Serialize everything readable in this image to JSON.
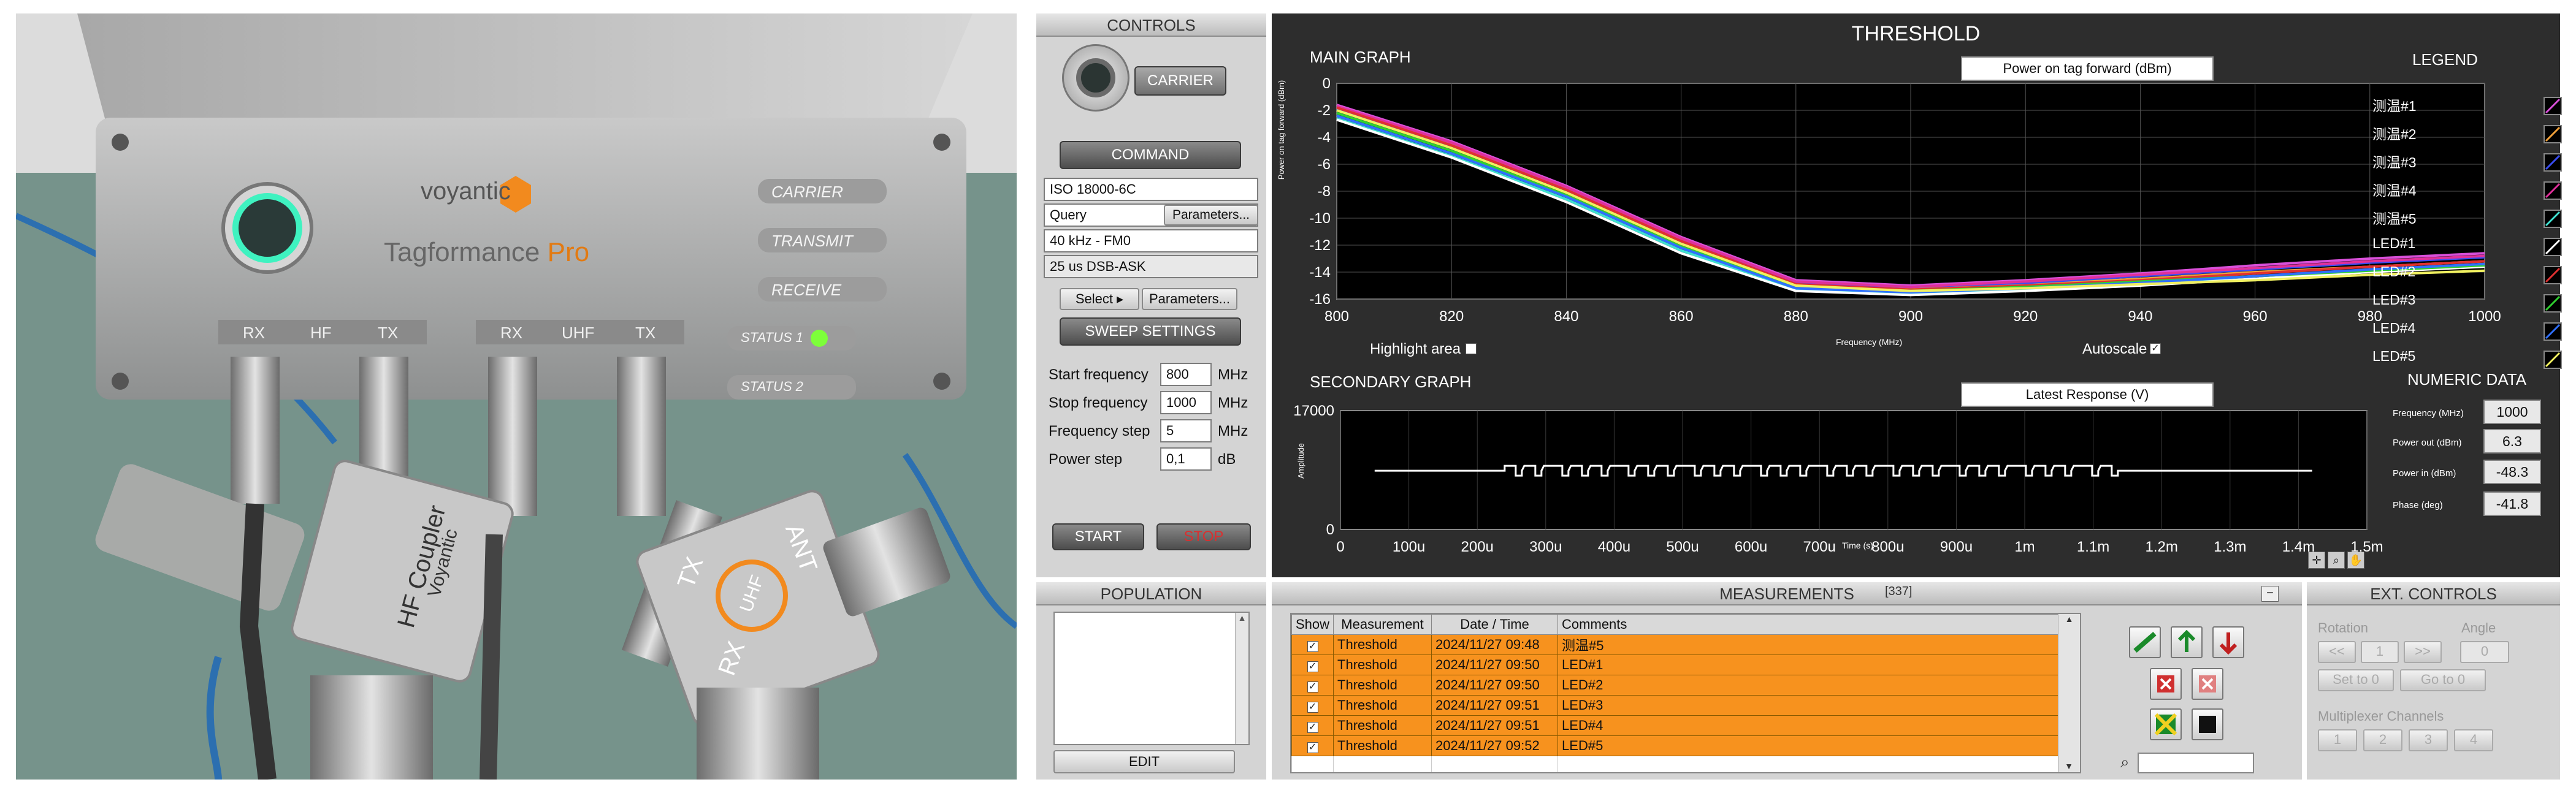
{
  "photo": {
    "brand": "voyantic",
    "product_name": "Tagformance",
    "product_suffix": "Pro",
    "panel_buttons": [
      "CARRIER",
      "TRANSMIT",
      "RECEIVE",
      "STATUS 1",
      "STATUS 2"
    ],
    "hf_port_labels": [
      "RX",
      "HF",
      "TX"
    ],
    "uhf_port_labels": [
      "RX",
      "UHF",
      "TX"
    ],
    "hf_coupler_label": "HF Coupler",
    "coupler_brand": "Voyantic",
    "uhf_tx": "TX",
    "uhf_ant": "ANT",
    "uhf_rx": "RX",
    "uhf_center": "UHF"
  },
  "controls": {
    "title": "CONTROLS",
    "carrier_label": "CARRIER",
    "command_label": "COMMAND",
    "protocol": "ISO 18000-6C",
    "command": "Query",
    "parameters_button": "Parameters...",
    "link_setting": "40 kHz - FM0",
    "modulation": "25 us DSB-ASK",
    "select_button": "Select",
    "parameters_button_2": "Parameters...",
    "sweep_settings_label": "SWEEP SETTINGS",
    "start_frequency_label": "Start frequency",
    "start_frequency_value": "800",
    "stop_frequency_label": "Stop frequency",
    "stop_frequency_value": "1000",
    "frequency_step_label": "Frequency step",
    "frequency_step_value": "5",
    "power_step_label": "Power step",
    "power_step_value": "0,1",
    "unit_mhz": "MHz",
    "unit_db": "dB",
    "start_button": "START",
    "stop_button": "STOP"
  },
  "population": {
    "title": "POPULATION",
    "edit_button": "EDIT"
  },
  "threshold": {
    "title": "THRESHOLD",
    "main_graph_label": "MAIN GRAPH",
    "main_graph_selector": "Power on tag forward (dBm)",
    "main_y_axis_label": "Power on tag forward (dBm)",
    "main_x_axis_label": "Frequency (MHz)",
    "highlight_area_label": "Highlight area",
    "autoscale_label": "Autoscale",
    "secondary_graph_label": "SECONDARY GRAPH",
    "secondary_selector": "Latest Response (V)",
    "secondary_y_axis_label": "Amplitude",
    "secondary_x_axis_label": "Time (s)",
    "legend_title": "LEGEND",
    "legend": [
      {
        "name": "测温#1",
        "color": "#d94fd9"
      },
      {
        "name": "测温#2",
        "color": "#f2a13a"
      },
      {
        "name": "测温#3",
        "color": "#3a4df2"
      },
      {
        "name": "测温#4",
        "color": "#e0309a"
      },
      {
        "name": "测温#5",
        "color": "#40e0d0"
      },
      {
        "name": "LED#1",
        "color": "#ffffff"
      },
      {
        "name": "LED#2",
        "color": "#e03030"
      },
      {
        "name": "LED#3",
        "color": "#30d030"
      },
      {
        "name": "LED#4",
        "color": "#3070ff"
      },
      {
        "name": "LED#5",
        "color": "#f0f060"
      }
    ],
    "numeric_title": "NUMERIC DATA",
    "numeric": [
      {
        "label": "Frequency (MHz)",
        "value": "1000"
      },
      {
        "label": "Power out (dBm)",
        "value": "6.3"
      },
      {
        "label": "Power in (dBm)",
        "value": "-48.3"
      },
      {
        "label": "Phase (deg)",
        "value": "-41.8"
      }
    ]
  },
  "chart_data": [
    {
      "type": "line",
      "title": "",
      "xlabel": "Frequency (MHz)",
      "ylabel": "Power on tag forward (dBm)",
      "xlim": [
        800,
        1000
      ],
      "ylim": [
        -16,
        0
      ],
      "x_ticks": [
        "800",
        "820",
        "840",
        "860",
        "880",
        "900",
        "920",
        "940",
        "960",
        "980",
        "1000"
      ],
      "y_ticks": [
        "0",
        "-2",
        "-4",
        "-6",
        "-8",
        "-10",
        "-12",
        "-14",
        "-16"
      ],
      "x": [
        800,
        820,
        840,
        860,
        880,
        900,
        920,
        940,
        960,
        980,
        1000
      ],
      "series": [
        {
          "name": "测温#1",
          "color": "#d94fd9",
          "values": [
            -1.6,
            -4.3,
            -7.6,
            -11.4,
            -14.6,
            -15.0,
            -14.6,
            -14.1,
            -13.5,
            -13.0,
            -12.6
          ]
        },
        {
          "name": "测温#2",
          "color": "#f2a13a",
          "values": [
            -1.8,
            -4.5,
            -7.8,
            -11.6,
            -14.8,
            -15.2,
            -14.9,
            -14.5,
            -14.0,
            -13.6,
            -13.2
          ]
        },
        {
          "name": "测温#3",
          "color": "#3a4df2",
          "values": [
            -1.9,
            -4.6,
            -7.9,
            -11.7,
            -14.8,
            -15.1,
            -14.8,
            -14.3,
            -13.8,
            -13.3,
            -12.9
          ]
        },
        {
          "name": "测温#4",
          "color": "#e0309a",
          "values": [
            -1.7,
            -4.4,
            -7.7,
            -11.5,
            -14.7,
            -15.1,
            -14.7,
            -14.2,
            -13.7,
            -13.2,
            -12.8
          ]
        },
        {
          "name": "测温#5",
          "color": "#40e0d0",
          "values": [
            -2.6,
            -5.4,
            -8.6,
            -12.4,
            -15.3,
            -15.6,
            -15.3,
            -14.9,
            -14.3,
            -13.9,
            -13.4
          ]
        },
        {
          "name": "LED#1",
          "color": "#ffffff",
          "values": [
            -2.7,
            -5.5,
            -8.8,
            -12.6,
            -15.4,
            -15.7,
            -15.4,
            -15.0,
            -14.5,
            -14.0,
            -13.6
          ]
        },
        {
          "name": "LED#2",
          "color": "#e03030",
          "values": [
            -1.8,
            -4.6,
            -7.9,
            -11.7,
            -14.9,
            -15.3,
            -15.0,
            -14.6,
            -14.1,
            -13.6,
            -13.2
          ]
        },
        {
          "name": "LED#3",
          "color": "#30d030",
          "values": [
            -2.2,
            -5.0,
            -8.3,
            -12.1,
            -15.1,
            -15.4,
            -15.1,
            -14.7,
            -14.3,
            -13.9,
            -13.5
          ]
        },
        {
          "name": "LED#4",
          "color": "#3070ff",
          "values": [
            -2.4,
            -5.2,
            -8.4,
            -12.2,
            -15.2,
            -15.5,
            -15.2,
            -14.8,
            -14.3,
            -13.8,
            -13.4
          ]
        },
        {
          "name": "LED#5",
          "color": "#f0f060",
          "values": [
            -2.0,
            -4.8,
            -8.1,
            -11.9,
            -15.0,
            -15.4,
            -15.2,
            -14.9,
            -14.6,
            -14.2,
            -13.9
          ]
        }
      ]
    },
    {
      "type": "line",
      "title": "",
      "xlabel": "Time (s)",
      "ylabel": "Amplitude",
      "x_ticks": [
        "0",
        "100u",
        "200u",
        "300u",
        "400u",
        "500u",
        "600u",
        "700u",
        "800u",
        "900u",
        "1m",
        "1.1m",
        "1.2m",
        "1.3m",
        "1.4m",
        "1.5m"
      ],
      "y_ticks": [
        "17000",
        "0"
      ],
      "xlim": [
        0,
        0.0015
      ],
      "ylim": [
        0,
        17000
      ],
      "series": [
        {
          "name": "",
          "color": "#ffffff",
          "baseline": 8400,
          "burst_start": 0.00024,
          "burst_end": 0.00112
        }
      ]
    }
  ],
  "measurements": {
    "title": "MEASUREMENTS",
    "count": "[337]",
    "columns": [
      "Show",
      "Measurement",
      "Date / Time",
      "Comments"
    ],
    "rows": [
      {
        "measurement": "Threshold",
        "datetime": "2024/11/27 09:48",
        "comment": "测温#5"
      },
      {
        "measurement": "Threshold",
        "datetime": "2024/11/27 09:50",
        "comment": "LED#1"
      },
      {
        "measurement": "Threshold",
        "datetime": "2024/11/27 09:50",
        "comment": "LED#2"
      },
      {
        "measurement": "Threshold",
        "datetime": "2024/11/27 09:51",
        "comment": "LED#3"
      },
      {
        "measurement": "Threshold",
        "datetime": "2024/11/27 09:51",
        "comment": "LED#4"
      },
      {
        "measurement": "Threshold",
        "datetime": "2024/11/27 09:52",
        "comment": "LED#5"
      }
    ]
  },
  "ext_controls": {
    "title": "EXT. CONTROLS",
    "rotation_label": "Rotation",
    "angle_label": "Angle",
    "rewind_button": "<<",
    "rotation_value": "1",
    "forward_button": ">>",
    "angle_value": "0",
    "set_to_0": "Set to 0",
    "go_to_0": "Go to 0",
    "multiplexer_label": "Multiplexer Channels",
    "channels": [
      "1",
      "2",
      "3",
      "4"
    ]
  }
}
